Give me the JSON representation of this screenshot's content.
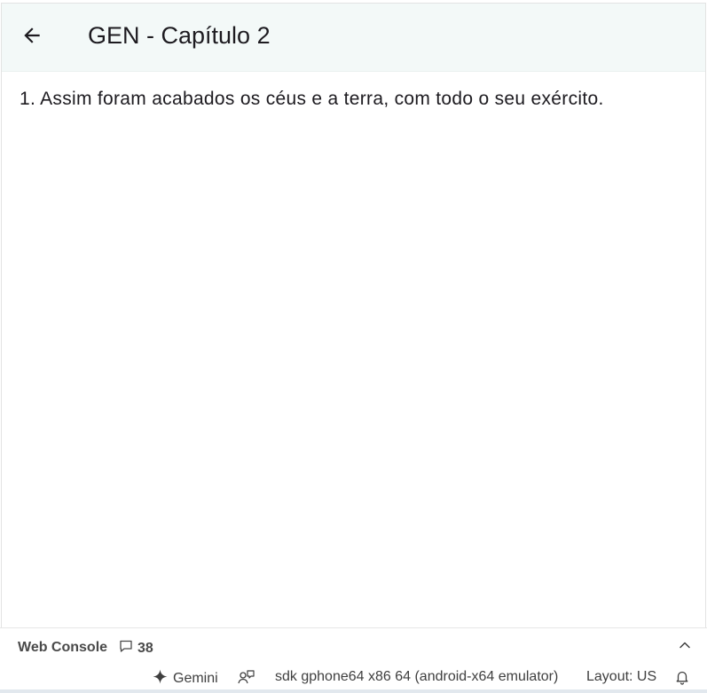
{
  "app_bar": {
    "back_icon": "arrow-left-icon",
    "title": "GEN - Capítulo 2"
  },
  "content": {
    "verses": [
      "1. Assim foram acabados os céus e a terra, com todo o seu exército."
    ]
  },
  "console": {
    "title": "Web Console",
    "message_icon": "comment-icon",
    "message_count": "38",
    "collapse_icon": "chevron-up-icon"
  },
  "status_bar": {
    "gemini_icon": "sparkle-icon",
    "gemini_label": "Gemini",
    "device_icon": "device-mirror-icon",
    "device_label": "sdk gphone64 x86 64 (android-x64 emulator)",
    "layout_label": "Layout: US",
    "bell_icon": "bell-icon"
  },
  "colors": {
    "app_bar_bg": "#f3f9f8",
    "text": "#1d1b20",
    "console_text": "#4a4a4a"
  }
}
